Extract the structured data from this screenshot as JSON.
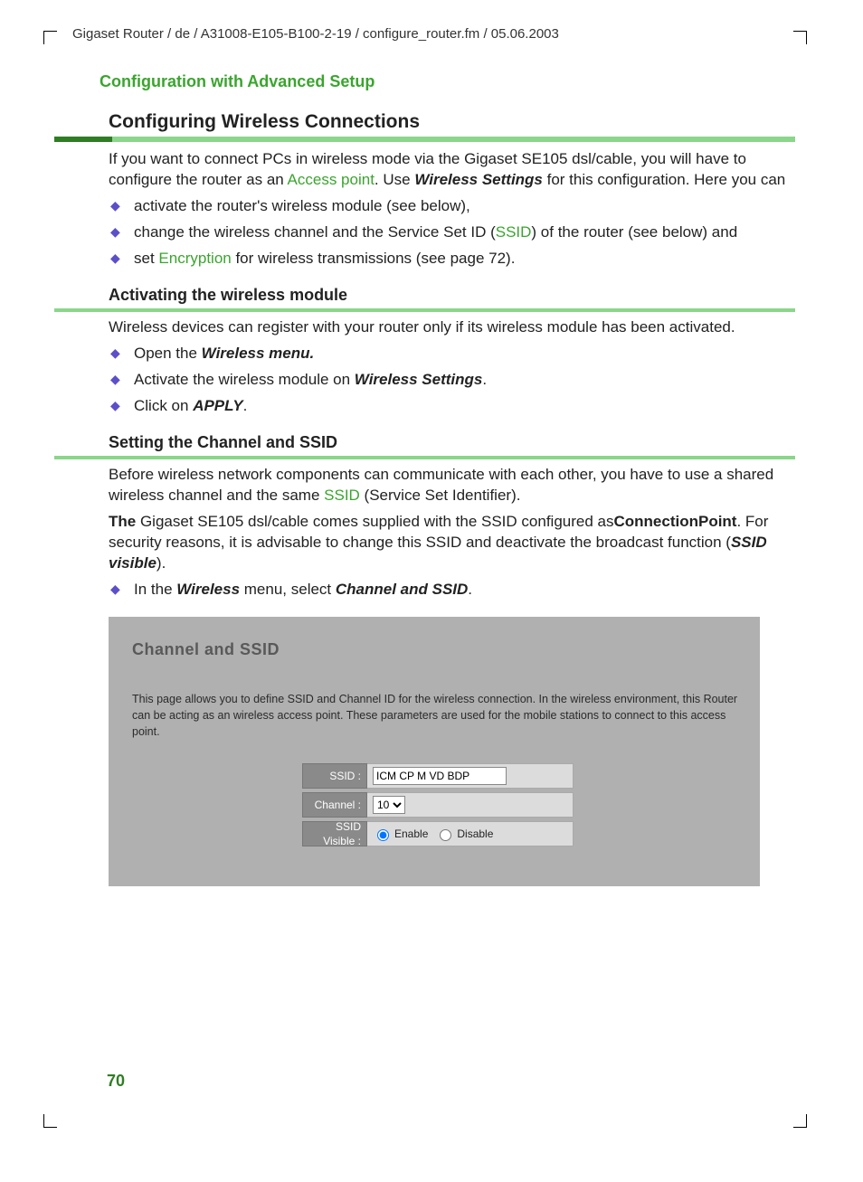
{
  "header": "Gigaset Router / de / A31008-E105-B100-2-19 / configure_router.fm / 05.06.2003",
  "section_title": "Configuration with Advanced Setup",
  "main_heading": "Configuring Wireless Connections",
  "intro": {
    "pre": "If you want to connect PCs in wireless mode via the Gigaset SE105 dsl/cable, you will have to configure the router as an ",
    "link1": "Access point",
    "mid": ". Use ",
    "bold1": "Wireless Settings",
    "post": " for this configuration. Here you can"
  },
  "bullets1": {
    "a": "activate the router's wireless module (see below),",
    "b_pre": "change the wireless channel and the Service Set ID (",
    "b_link": "SSID",
    "b_post": ") of the router (see below) and",
    "c_pre": "set ",
    "c_link": "Encryption",
    "c_post": " for wireless transmissions (see page 72)."
  },
  "sub1": {
    "title": "Activating the wireless module",
    "p": "Wireless devices can register with your router only if its wireless module has been activated.",
    "li1_pre": "Open the ",
    "li1_bold": "Wireless menu.",
    "li2_pre": "Activate the wireless module on ",
    "li2_bold": "Wireless Settings",
    "li2_post": ".",
    "li3_pre": "Click on ",
    "li3_bold": "APPLY",
    "li3_post": "."
  },
  "sub2": {
    "title": "Setting the Channel and SSID",
    "p1_pre": "Before wireless network components can communicate with each other, you have to use a shared wireless channel and the same ",
    "p1_link": "SSID",
    "p1_post": " (Service Set Identifier).",
    "p2_bold1": "The",
    "p2_mid1": "  Gigaset SE105 dsl/cable comes supplied with the SSID configured as",
    "p2_bold2": "ConnectionPoint",
    "p2_mid2": ". For security reasons, it is advisable to change this SSID and deactivate the broadcast function (",
    "p2_bold3": "SSID visible",
    "p2_post": ").",
    "li_pre": "In the ",
    "li_bold1": "Wireless",
    "li_mid": " menu, select ",
    "li_bold2": "Channel and SSID",
    "li_post": "."
  },
  "screenshot": {
    "title": "Channel and SSID",
    "desc": "This page allows you to define SSID and Channel ID for the wireless connection.  In the wireless environment, this Router can be acting as an wireless access point.  These parameters are used for the mobile stations to connect to this access point.",
    "labels": {
      "ssid": "SSID :",
      "channel": "Channel :",
      "visible": "SSID Visible :"
    },
    "values": {
      "ssid": "ICM CP M VD BDP",
      "channel": "10"
    },
    "radio": {
      "enable": "Enable",
      "disable": "Disable"
    }
  },
  "page_number": "70"
}
